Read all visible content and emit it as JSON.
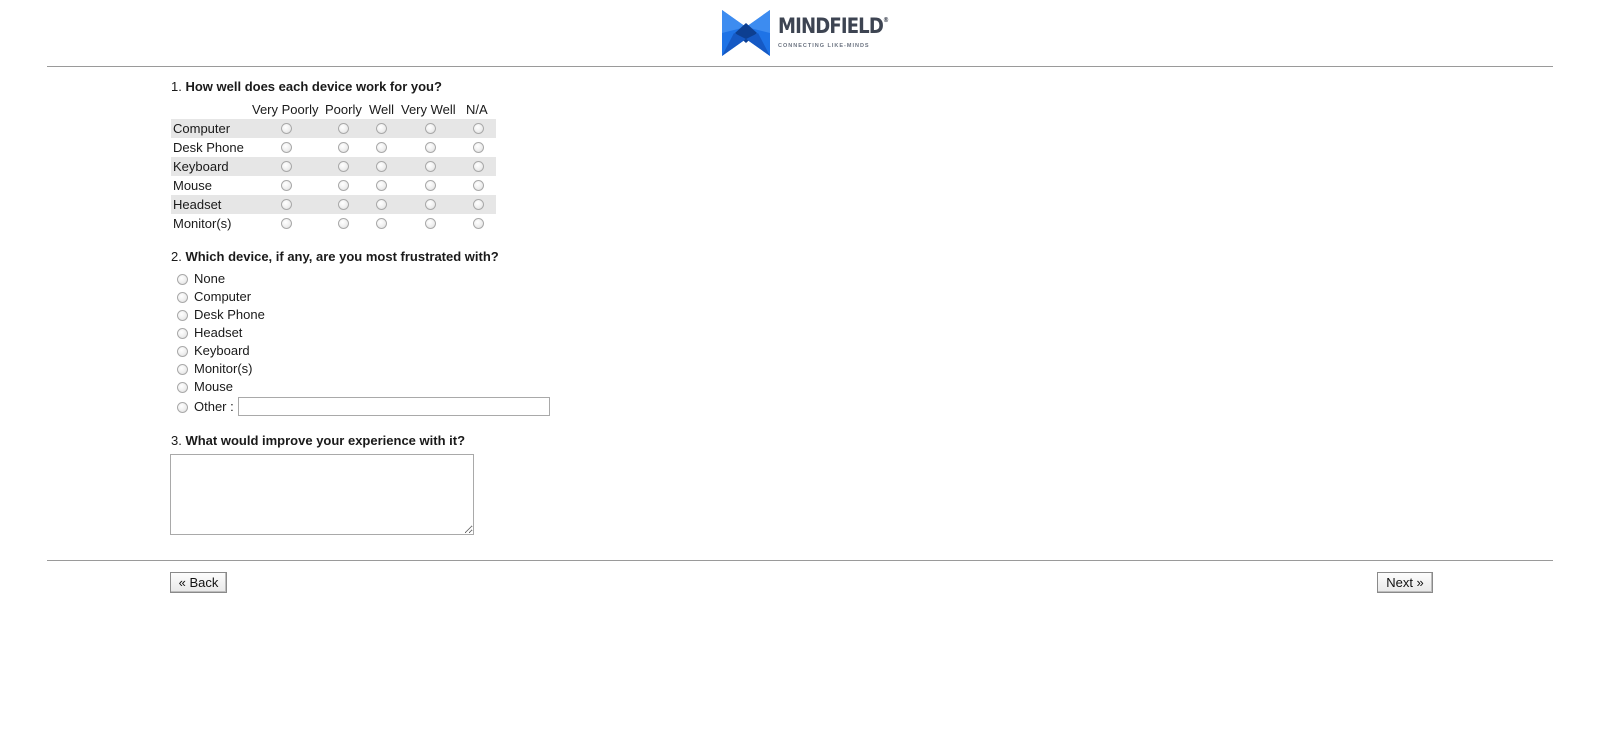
{
  "brand": {
    "name": "MINDFIELD",
    "registered_mark": "®",
    "tagline": "CONNECTING LIKE-MINDS",
    "colors": {
      "blue": "#1e73e6",
      "dark_blue": "#0d3f91",
      "wordmark": "#3d4452"
    }
  },
  "q1": {
    "number": "1.",
    "text": "How well does each device work for you?",
    "columns": [
      "Very Poorly",
      "Poorly",
      "Well",
      "Very Well",
      "N/A"
    ],
    "rows": [
      "Computer",
      "Desk Phone",
      "Keyboard",
      "Mouse",
      "Headset",
      "Monitor(s)"
    ]
  },
  "q2": {
    "number": "2.",
    "text": "Which device, if any, are you most frustrated with?",
    "options": [
      "None",
      "Computer",
      "Desk Phone",
      "Headset",
      "Keyboard",
      "Monitor(s)",
      "Mouse",
      "Other :"
    ],
    "other_value": ""
  },
  "q3": {
    "number": "3.",
    "text": "What would improve your experience with it?",
    "answer": ""
  },
  "nav": {
    "back_label": "« Back",
    "next_label": "Next »"
  }
}
